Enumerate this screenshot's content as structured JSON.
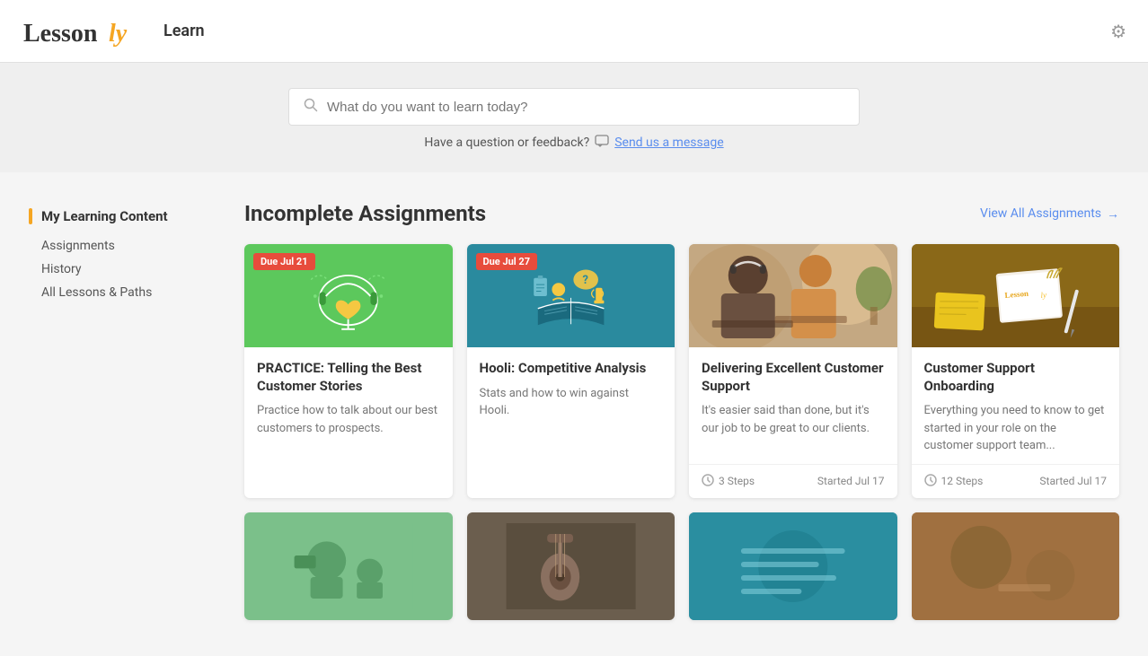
{
  "header": {
    "logo_text_1": "Lesson",
    "logo_text_2": "ly",
    "nav_label": "Learn",
    "gear_icon": "⚙"
  },
  "search": {
    "placeholder": "What do you want to learn today?",
    "feedback_text": "Have a question or feedback?",
    "send_message_label": "Send us a message"
  },
  "sidebar": {
    "heading": "My Learning Content",
    "items": [
      {
        "label": "Assignments",
        "href": "#"
      },
      {
        "label": "History",
        "href": "#"
      },
      {
        "label": "All Lessons & Paths",
        "href": "#"
      }
    ]
  },
  "main": {
    "section_title": "Incomplete Assignments",
    "view_all_label": "View All Assignments",
    "view_all_arrow": "→",
    "cards": [
      {
        "id": "card-1",
        "due": "Due Jul 21",
        "has_due": true,
        "img_type": "green",
        "title": "PRACTICE: Telling the Best Customer Stories",
        "desc": "Practice how to talk about our best customers to prospects.",
        "has_footer": false,
        "steps": null,
        "started": null
      },
      {
        "id": "card-2",
        "due": "Due Jul 27",
        "has_due": true,
        "img_type": "teal",
        "title": "Hooli: Competitive Analysis",
        "desc": "Stats and how to win against Hooli.",
        "has_footer": false,
        "steps": null,
        "started": null
      },
      {
        "id": "card-3",
        "due": null,
        "has_due": false,
        "img_type": "photo1",
        "title": "Delivering Excellent Customer Support",
        "desc": "It's easier said than done, but it's our job to be great to our clients.",
        "has_footer": true,
        "steps": "3 Steps",
        "started": "Started Jul 17"
      },
      {
        "id": "card-4",
        "due": null,
        "has_due": false,
        "img_type": "photo2",
        "title": "Customer Support Onboarding",
        "desc": "Everything you need to know to get started in your role on the customer support team...",
        "has_footer": true,
        "steps": "12 Steps",
        "started": "Started Jul 17"
      }
    ],
    "bottom_cards": [
      {
        "id": "bc-1",
        "img_type": "green2"
      },
      {
        "id": "bc-2",
        "img_type": "music"
      },
      {
        "id": "bc-3",
        "img_type": "teal2"
      },
      {
        "id": "bc-4",
        "img_type": "brown"
      }
    ]
  }
}
